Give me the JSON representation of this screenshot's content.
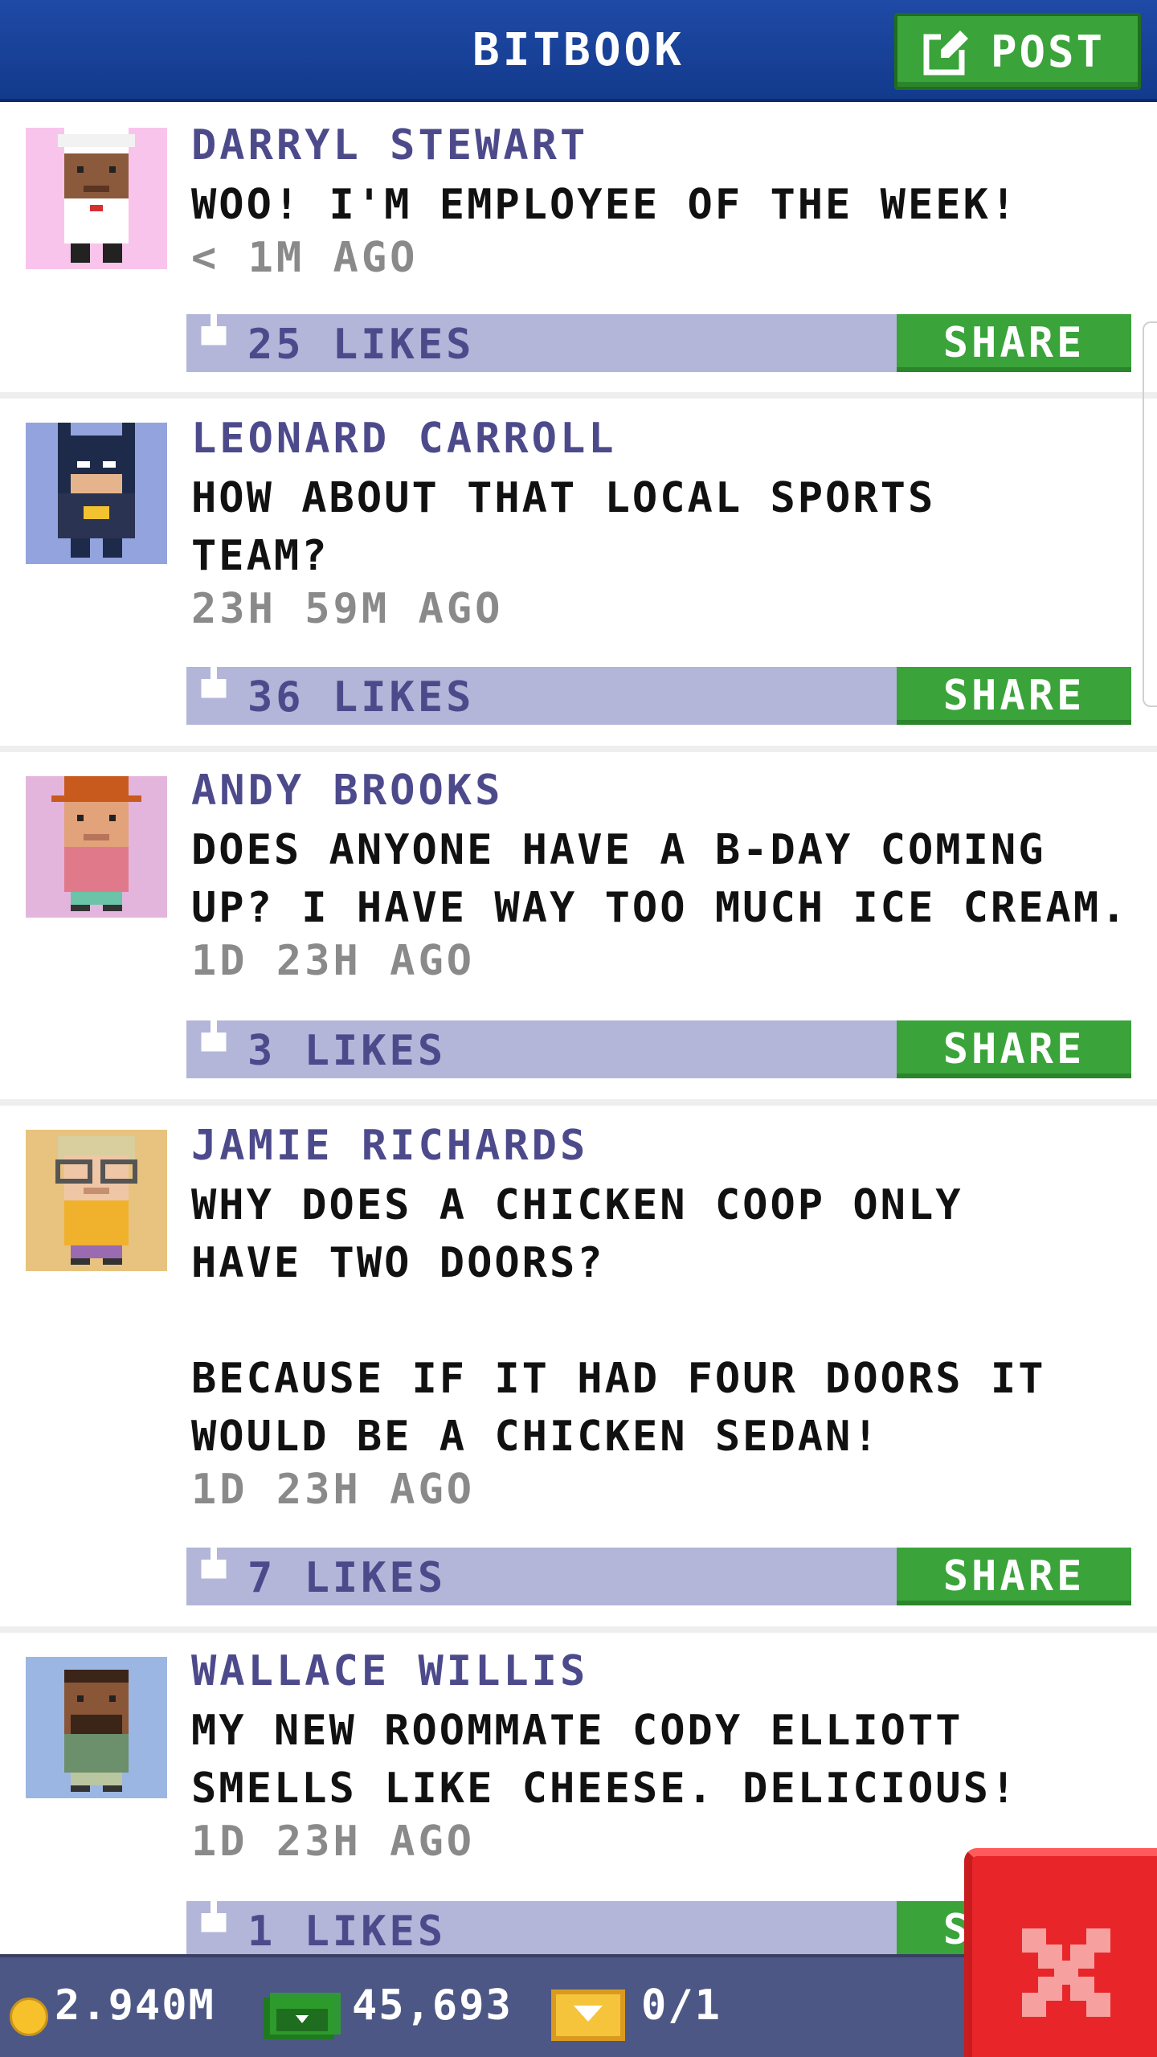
{
  "header": {
    "title": "BITBOOK",
    "post_label": "POST"
  },
  "posts": [
    {
      "author": "DARRYL STEWART",
      "message": "WOO! I'M EMPLOYEE OF THE WEEK!",
      "timestamp": "< 1M AGO",
      "likes": "25 LIKES",
      "share_label": "SHARE",
      "avatar_bg": "#f9c4ec"
    },
    {
      "author": "LEONARD CARROLL",
      "message": "HOW ABOUT THAT LOCAL SPORTS\nTEAM?",
      "timestamp": "23H 59M AGO",
      "likes": "36 LIKES",
      "share_label": "SHARE",
      "avatar_bg": "#93a3dd"
    },
    {
      "author": "ANDY BROOKS",
      "message": "DOES ANYONE HAVE A B-DAY COMING\nUP? I HAVE WAY TOO MUCH ICE CREAM.",
      "timestamp": "1D 23H AGO",
      "likes": "3 LIKES",
      "share_label": "SHARE",
      "avatar_bg": "#e3b5dd"
    },
    {
      "author": "JAMIE RICHARDS",
      "message": "WHY DOES A CHICKEN COOP ONLY\nHAVE TWO DOORS?\n\nBECAUSE IF IT HAD FOUR DOORS IT\nWOULD BE A CHICKEN SEDAN!",
      "timestamp": "1D 23H AGO",
      "likes": "7 LIKES",
      "share_label": "SHARE",
      "avatar_bg": "#e8c37f"
    },
    {
      "author": "WALLACE WILLIS",
      "message": "MY NEW ROOMMATE CODY ELLIOTT\nSMELLS LIKE CHEESE. DELICIOUS!",
      "timestamp": "1D 23H AGO",
      "likes": "1 LIKES",
      "share_label": "SHARE",
      "avatar_bg": "#9bb6e2"
    }
  ],
  "status_bar": {
    "coins": "2.940M",
    "cash": "45,693",
    "bux": "0/1"
  },
  "colors": {
    "header": "#1f4aa6",
    "accent_green": "#3aa33a",
    "likes_bar": "#b3b6d8",
    "author_text": "#4d4a8c",
    "close_red": "#e8262a"
  },
  "icons": {
    "post": "edit-icon",
    "like": "thumb-up-icon",
    "close": "close-icon",
    "coins": "coin-icon",
    "cash": "cash-icon",
    "bux": "bux-icon"
  }
}
